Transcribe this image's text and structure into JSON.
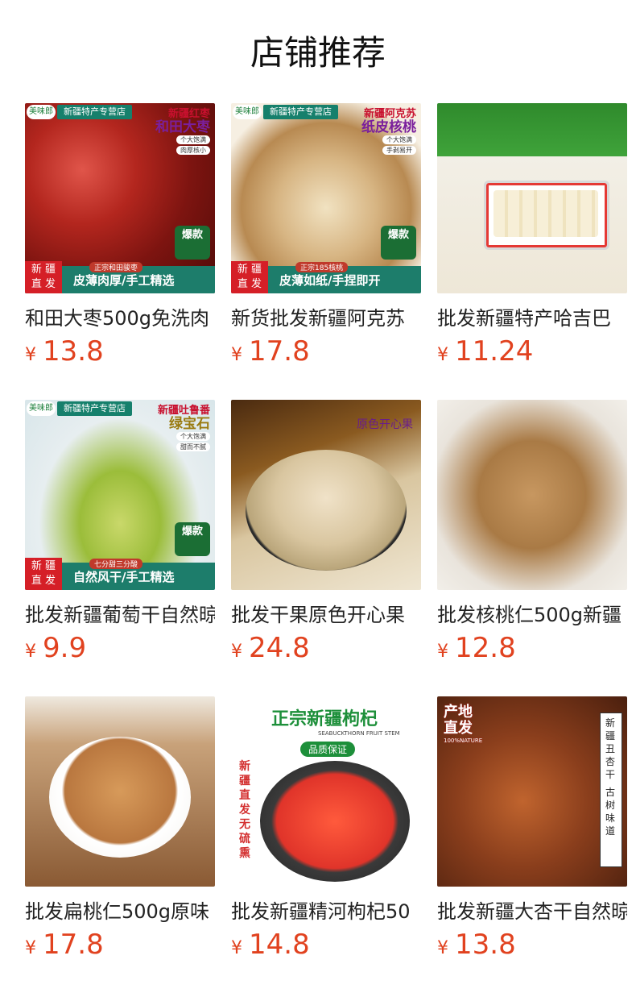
{
  "page": {
    "title": "店铺推荐"
  },
  "currency_symbol": "¥",
  "products": [
    {
      "name": "和田大枣500g免洗肉",
      "price": "13.8",
      "image": {
        "shop_label": "新疆特产专营店",
        "logo": "美味郎",
        "headline_small": "新疆红枣",
        "headline_big": "和田大枣",
        "tags": [
          "个大饱满",
          "肉厚核小"
        ],
        "bottom_left": [
          "新 疆",
          "直 发"
        ],
        "bottom_tagline": "正宗和田骏枣",
        "bottom_text": "皮薄肉厚/手工精选",
        "badge": "爆款",
        "accent": "#b3261e"
      }
    },
    {
      "name": "新货批发新疆阿克苏",
      "price": "17.8",
      "image": {
        "shop_label": "新疆特产专营店",
        "logo": "美味郎",
        "headline_small": "新疆阿克苏",
        "headline_big": "纸皮核桃",
        "tags": [
          "个大饱满",
          "手剥易开"
        ],
        "bottom_left": [
          "新 疆",
          "直 发"
        ],
        "bottom_tagline": "正宗185核桃",
        "bottom_text": "皮薄如纸/手捏即开",
        "badge": "爆款",
        "accent": "#c99a5b"
      }
    },
    {
      "name": "批发新疆特产哈吉巴",
      "price": "11.24",
      "image": {
        "accent": "#f3efe2"
      }
    },
    {
      "name": "批发新疆葡萄干自然晾",
      "price": "9.9",
      "image": {
        "shop_label": "新疆特产专营店",
        "logo": "美味郎",
        "headline_small": "新疆吐鲁番",
        "headline_big": "绿宝石",
        "tags": [
          "个大饱满",
          "甜而不腻"
        ],
        "bottom_left": [
          "新 疆",
          "直 发"
        ],
        "bottom_tagline": "七分甜三分酸",
        "bottom_text": "自然风干/手工精选",
        "badge": "爆款",
        "accent": "#9bbd3a"
      }
    },
    {
      "name": "批发干果原色开心果",
      "price": "24.8",
      "image": {
        "overlay_text": "原色开心果",
        "accent": "#d9c6a0"
      }
    },
    {
      "name": "批发核桃仁500g新疆",
      "price": "12.8",
      "image": {
        "accent": "#a97a45"
      }
    },
    {
      "name": "批发扁桃仁500g原味",
      "price": "17.8",
      "image": {
        "accent": "#b9773f"
      }
    },
    {
      "name": "批发新疆精河枸杞50",
      "price": "14.8",
      "image": {
        "headline": "正宗新疆枸杞",
        "subline": "SEABUCKTHORN FRUIT STEM",
        "quality": "品质保证",
        "side_text": "新疆直发无硫熏",
        "accent": "#e0342a"
      }
    },
    {
      "name": "批发新疆大杏干自然晾",
      "price": "13.8",
      "image": {
        "corner_text": [
          "产地",
          "直发"
        ],
        "corner_sub": "100%NATURE",
        "side_right": "新疆丑杏干",
        "side_right2": "古树味道",
        "accent": "#8a3e1c"
      }
    }
  ]
}
